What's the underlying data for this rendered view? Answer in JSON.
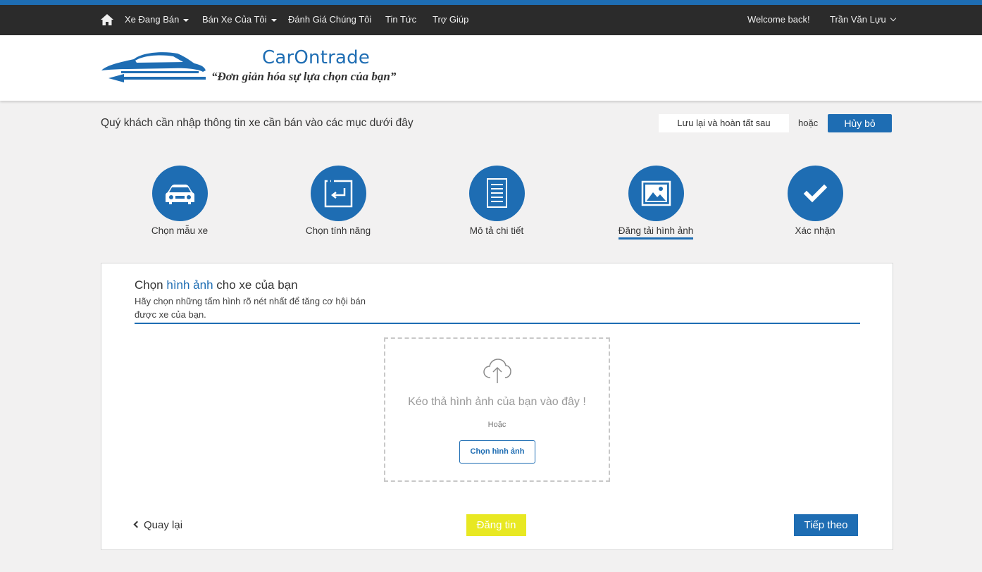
{
  "colors": {
    "brand": "#1e6db3",
    "navbar": "#2b2b2b",
    "post_button": "#e8e822",
    "background": "#f2f1f1"
  },
  "navbar": {
    "home_icon": "home-icon",
    "items": [
      {
        "label": "Xe Đang Bán",
        "has_dropdown": true
      },
      {
        "label": "Bán Xe Của Tôi",
        "has_dropdown": true
      },
      {
        "label": "Đánh Giá Chúng Tôi",
        "has_dropdown": false
      },
      {
        "label": "Tin Tức",
        "has_dropdown": false
      },
      {
        "label": "Trợ Giúp",
        "has_dropdown": false
      }
    ],
    "welcome": "Welcome back!",
    "user_name": "Trần Văn Lựu"
  },
  "header": {
    "logo_name": "CarOntrade",
    "slogan": "“Đơn giản hóa sự lựa chọn của bạn”"
  },
  "toolbar": {
    "intro": "Quý khách cần nhập thông tin xe cần bán vào các mục dưới đây",
    "save_later": "Lưu lại và hoàn tất sau",
    "or": "hoặc",
    "cancel": "Hủy bỏ"
  },
  "steps": [
    {
      "label": "Chọn mẫu xe",
      "icon": "car-icon",
      "active": false
    },
    {
      "label": "Chọn tính năng",
      "icon": "feature-select-icon",
      "active": false
    },
    {
      "label": "Mô tả chi tiết",
      "icon": "document-icon",
      "active": false
    },
    {
      "label": "Đăng tải hình ảnh",
      "icon": "image-icon",
      "active": true
    },
    {
      "label": "Xác nhận",
      "icon": "check-icon",
      "active": false
    }
  ],
  "panel": {
    "title_pre": "Chọn ",
    "title_highlight": "hình ảnh",
    "title_post": " cho xe của bạn",
    "description": "Hãy chọn những tấm hình rõ nét nhất để tăng cơ hội bán được xe của bạn.",
    "dropzone": {
      "icon": "cloud-upload-icon",
      "text": "Kéo thả hình ảnh của bạn vào đây !",
      "or": "Hoặc",
      "choose_button": "Chọn hình ảnh"
    },
    "back": "Quay lại",
    "post": "Đăng tin",
    "next": "Tiếp theo"
  }
}
